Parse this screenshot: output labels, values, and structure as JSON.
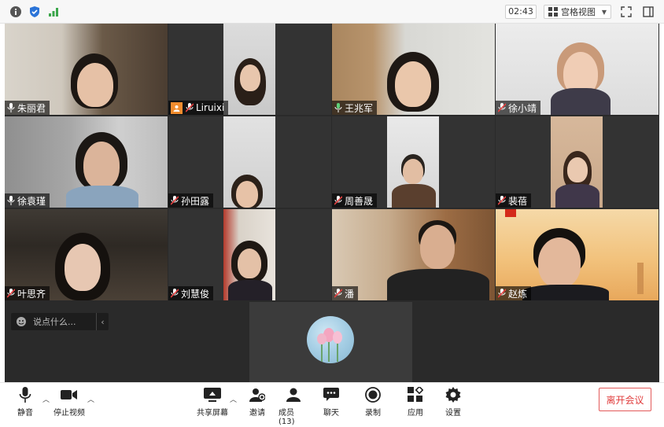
{
  "topbar": {
    "timer": "02:43",
    "view_mode": "宫格视图"
  },
  "participants": [
    {
      "name": "朱丽君"
    },
    {
      "name": "Liruixi"
    },
    {
      "name": "王兆军"
    },
    {
      "name": "徐小靖"
    },
    {
      "name": "徐袁瑾"
    },
    {
      "name": "孙田露"
    },
    {
      "name": "周善晟"
    },
    {
      "name": "裴蓓"
    },
    {
      "name": "叶思齐"
    },
    {
      "name": "刘慧俊"
    },
    {
      "name": "潘"
    },
    {
      "name": "赵炼"
    }
  ],
  "chat": {
    "placeholder": "说点什么...",
    "collapse": "‹"
  },
  "toolbar": {
    "mute": "静音",
    "stop_video": "停止视频",
    "share_screen": "共享屏幕",
    "invite": "邀请",
    "members": "成员(13)",
    "chat": "聊天",
    "record": "录制",
    "apps": "应用",
    "settings": "设置",
    "leave": "离开会议"
  },
  "colors": {
    "accent": "#2fb15c",
    "leave": "#e03c3c"
  }
}
